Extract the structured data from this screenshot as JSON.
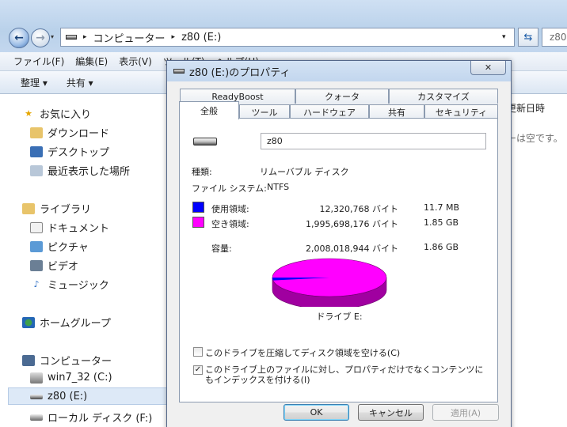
{
  "explorer": {
    "back_glyph": "←",
    "forward_glyph": "→",
    "history_glyph": "▾",
    "address": {
      "chevron": "▸",
      "segments": [
        "コンピューター",
        "z80 (E:)"
      ]
    },
    "dropdown_glyph": "▾",
    "refresh_glyph": "⇆",
    "search_placeholder": "z80",
    "menu": [
      "ファイル(F)",
      "編集(E)",
      "表示(V)",
      "ツール(T)",
      "ヘルプ(H)"
    ],
    "commands": [
      "整理 ▾",
      "共有 ▾"
    ],
    "nav": {
      "favorites": "お気に入り",
      "downloads": "ダウンロード",
      "desktop": "デスクトップ",
      "recent": "最近表示した場所",
      "libraries": "ライブラリ",
      "documents": "ドキュメント",
      "pictures": "ピクチャ",
      "videos": "ビデオ",
      "music": "ミュージック",
      "homegroup": "ホームグループ",
      "computer": "コンピューター",
      "drive_c": "win7_32 (C:)",
      "drive_e": "z80 (E:)",
      "drive_f": "ローカル ディスク (F:)"
    },
    "column_header": "更新日時",
    "empty_text": "ーは空です。"
  },
  "dialog": {
    "title": "z80 (E:)のプロパティ",
    "close_glyph": "✕",
    "tabs_top": [
      "ReadyBoost",
      "クォータ",
      "カスタマイズ"
    ],
    "tabs_bottom": [
      "全般",
      "ツール",
      "ハードウェア",
      "共有",
      "セキュリティ"
    ],
    "volume_name": "z80",
    "type_label": "種類:",
    "type_value": "リムーバブル ディスク",
    "fs_label": "ファイル システム:",
    "fs_value": "NTFS",
    "used_label": "使用領域:",
    "used_bytes": "12,320,768 バイト",
    "used_size": "11.7 MB",
    "free_label": "空き領域:",
    "free_bytes": "1,995,698,176 バイト",
    "free_size": "1.85 GB",
    "cap_label": "容量:",
    "cap_bytes": "2,008,018,944 バイト",
    "cap_size": "1.86 GB",
    "drive_label": "ドライブ E:",
    "compress_label": "このドライブを圧縮してディスク領域を空ける(C)",
    "compress_checked": false,
    "index_label": "このドライブ上のファイルに対し、プロパティだけでなくコンテンツにもインデックスを付ける(I)",
    "index_checked": true,
    "check_glyph": "✓",
    "ok": "OK",
    "cancel": "キャンセル",
    "apply": "適用(A)",
    "colors": {
      "used": "#0000ff",
      "free": "#ff00ff",
      "free_dark": "#a000a0"
    },
    "used_fraction": 0.0061
  }
}
